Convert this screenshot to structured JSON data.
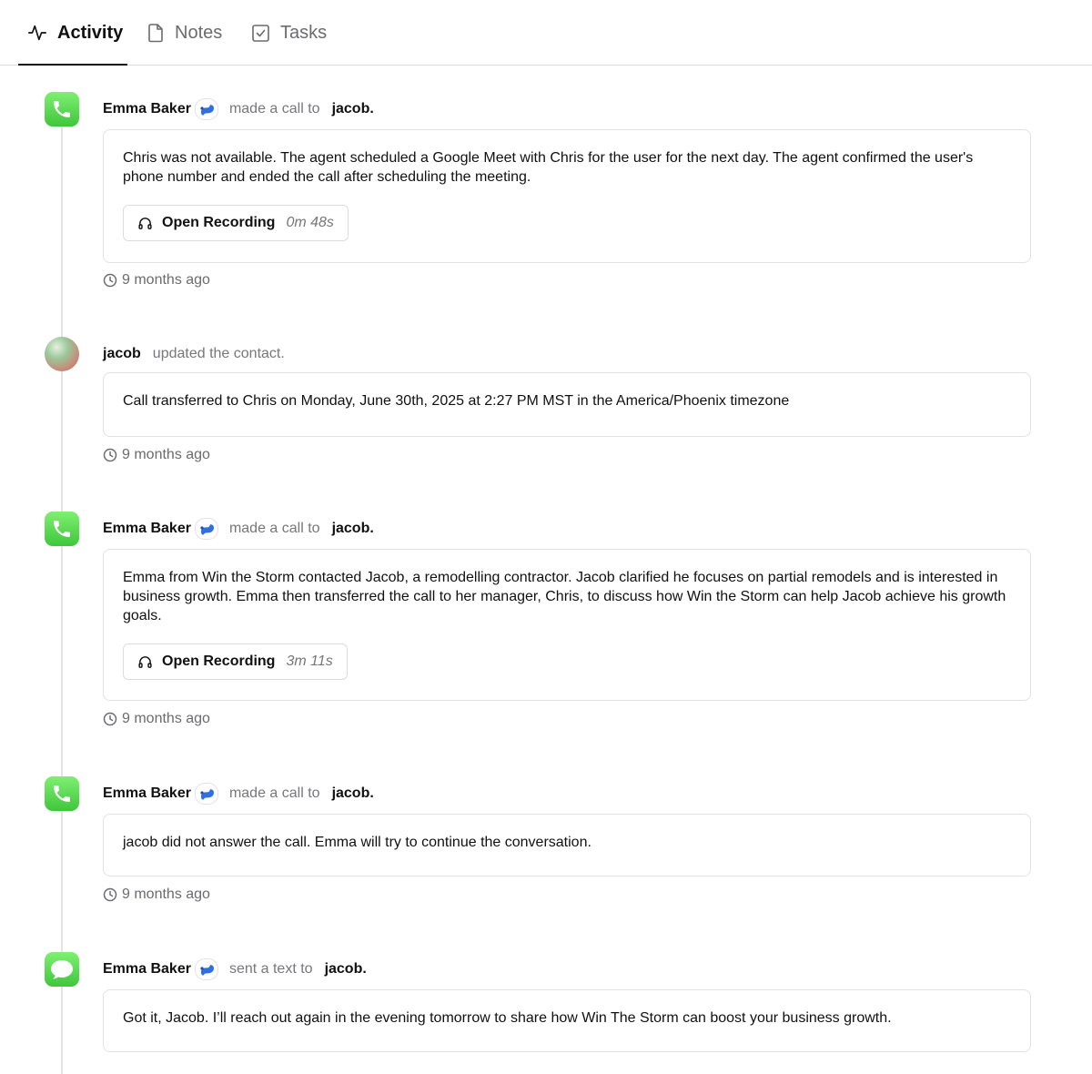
{
  "tabs": [
    {
      "label": "Activity",
      "icon": "activity-icon",
      "active": true
    },
    {
      "label": "Notes",
      "icon": "note-icon",
      "active": false
    },
    {
      "label": "Tasks",
      "icon": "task-checkbox-icon",
      "active": false
    }
  ],
  "events": [
    {
      "type": "call",
      "actor": "Emma Baker",
      "action": "made a call to",
      "target": "jacob.",
      "text": "Chris was not available. The agent scheduled a Google Meet with Chris for the user for the next day. The agent confirmed the user's phone number and ended the call after scheduling the meeting.",
      "recording": {
        "label": "Open Recording",
        "duration": "0m 48s"
      },
      "time": "9 months ago"
    },
    {
      "type": "update",
      "actor": "jacob",
      "action": "updated the contact.",
      "text": "Call transferred to Chris on Monday, June 30th, 2025 at 2:27 PM MST in the America/Phoenix timezone",
      "time": "9 months ago"
    },
    {
      "type": "call",
      "actor": "Emma Baker",
      "action": "made a call to",
      "target": "jacob.",
      "text": "Emma from Win the Storm contacted Jacob, a remodelling contractor. Jacob clarified he focuses on partial remodels and is interested in business growth. Emma then transferred the call to her manager, Chris, to discuss how Win the Storm can help Jacob achieve his growth goals.",
      "recording": {
        "label": "Open Recording",
        "duration": "3m 11s"
      },
      "time": "9 months ago"
    },
    {
      "type": "call",
      "actor": "Emma Baker",
      "action": "made a call to",
      "target": "jacob.",
      "text": "jacob did not answer the call. Emma will try to continue the conversation.",
      "time": "9 months ago"
    },
    {
      "type": "text",
      "actor": "Emma Baker",
      "action": "sent a text to",
      "target": "jacob.",
      "text": "Got it, Jacob. I’ll reach out again in the evening tomorrow to share how Win The Storm can boost your business growth."
    }
  ],
  "colors": {
    "call_icon_green": "#4cd44a",
    "agent_badge_blue": "#2f6fe0",
    "muted_text": "#77777c",
    "border": "#e2e2e6"
  }
}
